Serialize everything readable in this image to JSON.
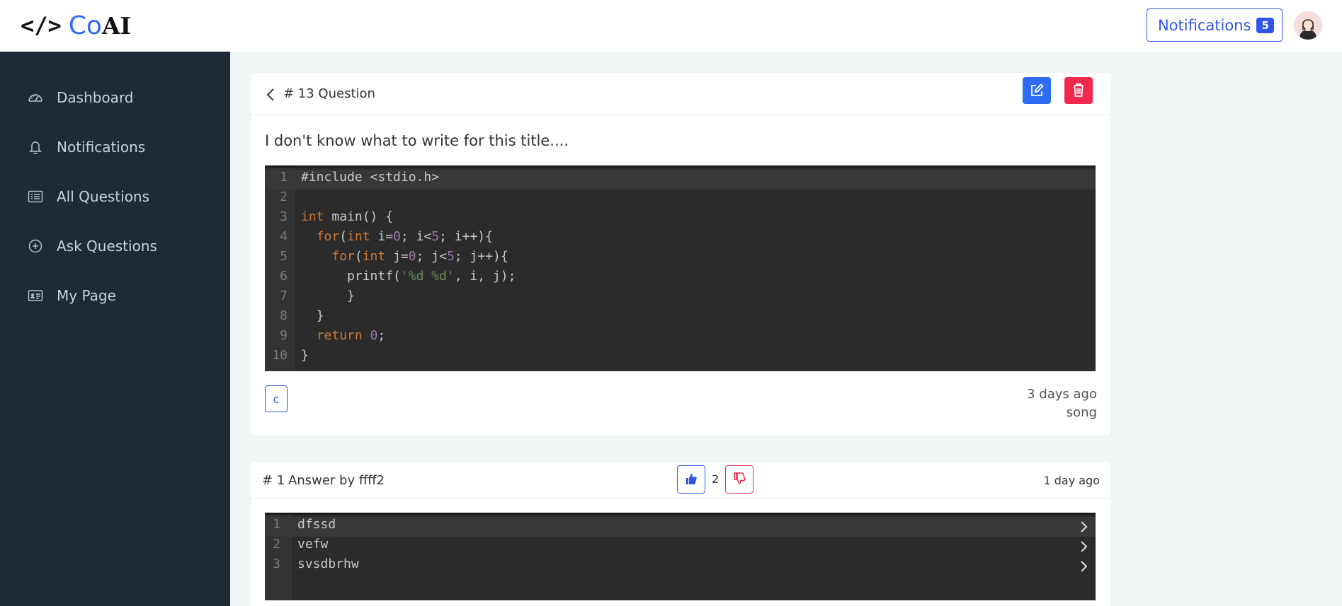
{
  "header": {
    "logo_code": "</>",
    "logo_co": "Co",
    "logo_ai": "AI",
    "notifications_label": "Notifications",
    "notifications_count": "5"
  },
  "sidebar": {
    "items": [
      {
        "label": "Dashboard",
        "icon": "gauge-icon"
      },
      {
        "label": "Notifications",
        "icon": "bell-icon"
      },
      {
        "label": "All Questions",
        "icon": "list-icon"
      },
      {
        "label": "Ask Questions",
        "icon": "plus-circle-icon"
      },
      {
        "label": "My Page",
        "icon": "id-card-icon"
      }
    ]
  },
  "question": {
    "number": "# 13 Question",
    "title": "I don't know what to write for this title....",
    "code_lines": [
      {
        "n": "1",
        "text": "#include <stdio.h>"
      },
      {
        "n": "2",
        "text": ""
      },
      {
        "n": "3",
        "text": "int main() {"
      },
      {
        "n": "4",
        "text": "  for(int i=0; i<5; i++){"
      },
      {
        "n": "5",
        "text": "    for(int j=0; j<5; j++){"
      },
      {
        "n": "6",
        "text": "      printf('%d %d', i, j);"
      },
      {
        "n": "7",
        "text": "      }"
      },
      {
        "n": "8",
        "text": "  }"
      },
      {
        "n": "9",
        "text": "  return 0;"
      },
      {
        "n": "10",
        "text": "}"
      }
    ],
    "tag": "c",
    "time": "3 days ago",
    "author": "song"
  },
  "answer": {
    "number": "# 1",
    "by": "Answer by ffff2",
    "likes": "2",
    "time": "1 day ago",
    "code_lines": [
      {
        "n": "1",
        "text": "dfssd"
      },
      {
        "n": "2",
        "text": "vefw"
      },
      {
        "n": "3",
        "text": "svsdbrhw"
      }
    ]
  },
  "colors": {
    "primary": "#2f56e8",
    "danger": "#f3284f",
    "sidebar_bg": "#1f2a38",
    "code_bg": "#2b2b2b"
  }
}
